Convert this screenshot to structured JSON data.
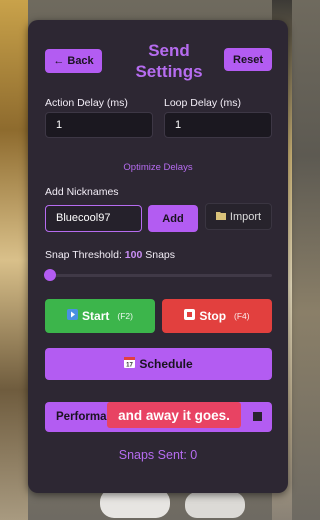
{
  "panel": {
    "back_label": "← Back",
    "title_line1": "Send",
    "title_line2": "Settings",
    "reset_label": "Reset"
  },
  "delays": {
    "action_label": "Action Delay (ms)",
    "action_value": "1",
    "loop_label": "Loop Delay (ms)",
    "loop_value": "1",
    "optimize_link": "Optimize Delays"
  },
  "nicknames": {
    "label": "Add Nicknames",
    "value": "Bluecool97",
    "add_label": "Add",
    "import_label": "Import"
  },
  "threshold": {
    "label_prefix": "Snap Threshold:",
    "value": "100",
    "label_suffix": "Snaps",
    "slider_fraction": 0.0
  },
  "controls": {
    "start_label": "Start",
    "start_key": "(F2)",
    "stop_label": "Stop",
    "stop_key": "(F4)",
    "schedule_label": "Schedule",
    "performance_label": "Performance Mode (F8)"
  },
  "status": {
    "snaps_sent": "Snaps Sent: 0"
  },
  "caption": "and away it goes.",
  "colors": {
    "accent": "#b35cf2",
    "start": "#3cb54b",
    "stop": "#e2403e",
    "caption_bg": "#e84363"
  },
  "icons": {
    "import": "folder-icon",
    "start": "play-icon",
    "stop": "stop-icon",
    "schedule": "calendar-icon"
  }
}
